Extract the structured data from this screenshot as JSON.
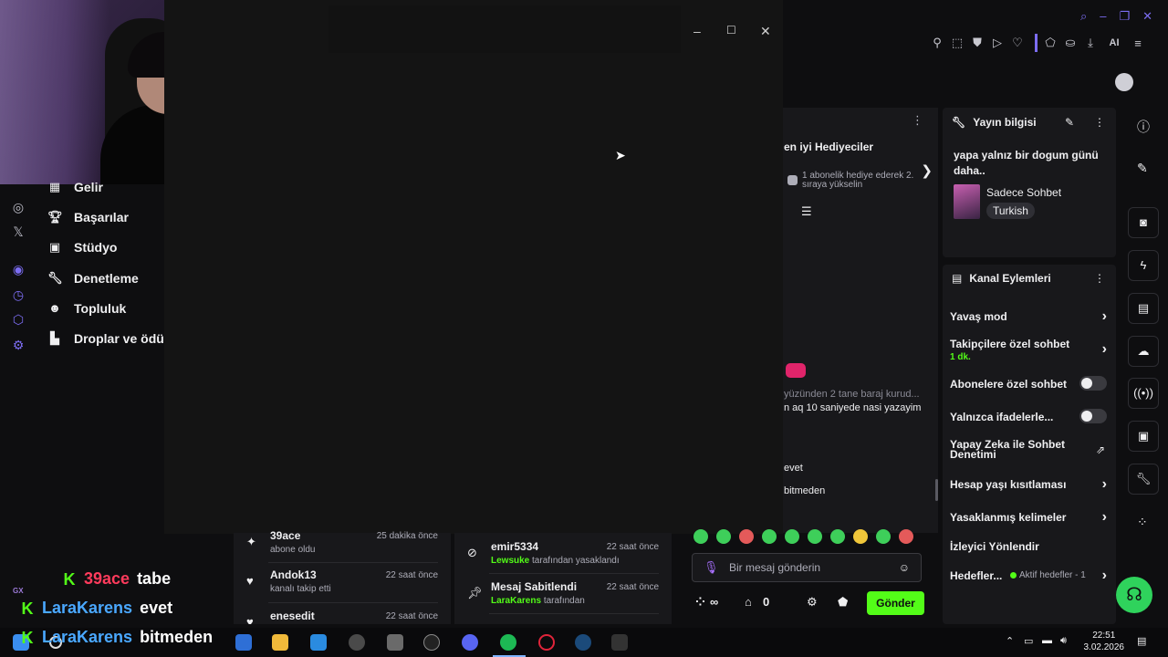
{
  "creator_nav": [
    {
      "icon": "revenue-icon",
      "label": "Gelir"
    },
    {
      "icon": "trophy-icon",
      "label": "Başarılar"
    },
    {
      "icon": "studio-icon",
      "label": "Stüdyo"
    },
    {
      "icon": "wrench-icon",
      "label": "Denetleme"
    },
    {
      "icon": "community-icon",
      "label": "Topluluk"
    },
    {
      "icon": "drops-icon",
      "label": "Droplar ve ödül"
    }
  ],
  "window_controls": {
    "minimize": "–",
    "maximize": "☐",
    "close": "✕"
  },
  "chat": {
    "gifters_title": "en iyi Hediyeciler",
    "gifter_hint": "1 abonelik hediye ederek 2. sıraya yükselin",
    "messages": [
      {
        "text": "yüzünden 2 tane baraj kurud...",
        "dim": true
      },
      {
        "text": "n aq 10 saniyede nasi yazayim",
        "dim": false
      },
      {
        "text": "evet",
        "dim": false
      },
      {
        "text": "bitmeden",
        "dim": false
      }
    ],
    "input_placeholder": "Bir mesaj gönderin",
    "infinity_label": "∞",
    "points_value": "0",
    "send_label": "Gönder"
  },
  "activity_left": [
    {
      "icon": "sparkle-icon",
      "name": "39ace",
      "time": "25 dakika önce",
      "sub": "abone oldu"
    },
    {
      "icon": "heart-icon",
      "name": "Andok13",
      "time": "22 saat önce",
      "sub": "kanalı takip etti"
    },
    {
      "icon": "heart-icon",
      "name": "enesedit",
      "time": "22 saat önce",
      "sub": ""
    }
  ],
  "activity_right": [
    {
      "icon": "ban-icon",
      "name": "emir5334",
      "time": "22 saat önce",
      "sub_user": "Lewsuke",
      "sub_text": "tarafından yasaklandı"
    },
    {
      "icon": "pin-icon",
      "name": "Mesaj Sabitlendi",
      "time": "22 saat önce",
      "sub_user": "LaraKarens",
      "sub_text": "tarafından"
    }
  ],
  "stream_info": {
    "title": "Yayın bilgisi",
    "stream_title": "yapa yalnız bir dogum günü daha..",
    "category": "Sadece Sohbet",
    "tag": "Turkish"
  },
  "channel_actions": {
    "title": "Kanal Eylemleri",
    "items": [
      {
        "label": "Yavaş mod",
        "type": "chevron",
        "sub": ""
      },
      {
        "label": "Takipçilere özel sohbet",
        "type": "chevron",
        "sub": "1 dk."
      },
      {
        "label": "Abonelere özel sohbet",
        "type": "toggle",
        "sub": ""
      },
      {
        "label": "Yalnızca ifadelerle...",
        "type": "toggle",
        "sub": ""
      },
      {
        "label": "Yapay Zeka ile Sohbet Denetimi",
        "type": "external",
        "sub": ""
      },
      {
        "label": "Hesap yaşı kısıtlaması",
        "type": "chevron",
        "sub": ""
      },
      {
        "label": "Yasaklanmış kelimeler",
        "type": "chevron",
        "sub": ""
      },
      {
        "label": "İzleyici Yönlendir",
        "type": "none",
        "sub": ""
      },
      {
        "label": "Hedefler...",
        "type": "chevron",
        "sub": ""
      }
    ],
    "goals_status": "Aktif hedefler - 1"
  },
  "toolbar_ai": "AI",
  "stream_overlay_chat": [
    {
      "name": "39ace",
      "color": "red",
      "text": "tabe"
    },
    {
      "name": "LaraKarens",
      "color": "blue",
      "text": "evet"
    },
    {
      "name": "LaraKarens",
      "color": "blue",
      "text": "bitmeden"
    }
  ],
  "overlay_gx": "GX",
  "taskbar": {
    "time": "22:51",
    "date": "3.02.2026"
  },
  "colors": {
    "accent": "#53fc18",
    "purple": "#7c6df2",
    "bg": "#0e0e10",
    "panel": "#18181b"
  }
}
